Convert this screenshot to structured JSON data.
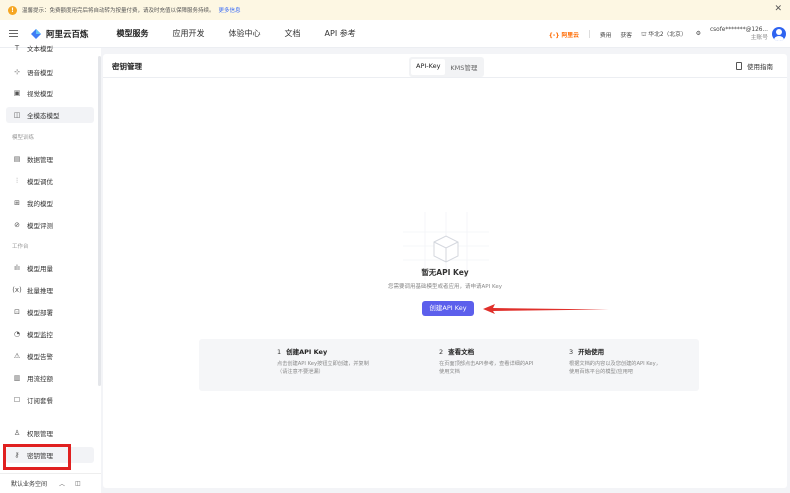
{
  "notice": {
    "text": "温馨提示：免费额度用完后将自动转为按量付费，请及时充值以保障服务持续。",
    "more": "更多信息"
  },
  "topnav": {
    "logo": "阿里云百炼",
    "menu": [
      "模型服务",
      "应用开发",
      "体验中心",
      "文档",
      "API 参考"
    ],
    "brand": "阿里云",
    "fee": "费用",
    "ticket": "获客",
    "region": "华北2（北京）",
    "user_name": "csofe*******@126...",
    "user_role": "主账号"
  },
  "sidebar": {
    "items_top": [
      {
        "icon": "text-model-icon",
        "glyph": "T",
        "label": "文本模型"
      },
      {
        "icon": "audio-model-icon",
        "glyph": "⊹",
        "label": "语音模型"
      },
      {
        "icon": "vision-model-icon",
        "glyph": "▣",
        "label": "视觉模型"
      },
      {
        "icon": "omni-model-icon",
        "glyph": "◫",
        "label": "全模态模型"
      }
    ],
    "group_training": "模型训练",
    "items_training": [
      {
        "icon": "data-manage-icon",
        "glyph": "▤",
        "label": "数据管理"
      },
      {
        "icon": "tuning-icon",
        "glyph": "⫶",
        "label": "模型调优"
      },
      {
        "icon": "my-models-icon",
        "glyph": "⊞",
        "label": "我的模型"
      },
      {
        "icon": "evaluation-icon",
        "glyph": "⊘",
        "label": "模型评测"
      }
    ],
    "group_work": "工作台",
    "items_work": [
      {
        "icon": "usage-icon",
        "glyph": "ılı",
        "label": "模型用量"
      },
      {
        "icon": "batch-icon",
        "glyph": "(x)",
        "label": "批量推理"
      },
      {
        "icon": "deploy-icon",
        "glyph": "⊡",
        "label": "模型部署"
      },
      {
        "icon": "monitor-icon",
        "glyph": "◔",
        "label": "模型监控"
      },
      {
        "icon": "alert-icon",
        "glyph": "⚠",
        "label": "模型告警"
      },
      {
        "icon": "traffic-icon",
        "glyph": "▥",
        "label": "用流控额"
      },
      {
        "icon": "subscribe-icon",
        "glyph": "☐",
        "label": "订阅套餐"
      }
    ],
    "items_bottom": [
      {
        "icon": "permission-icon",
        "glyph": "♙",
        "label": "权限管理"
      },
      {
        "icon": "key-icon",
        "glyph": "⚷",
        "label": "密钥管理"
      }
    ],
    "workspace": "默认业务空间"
  },
  "page": {
    "title": "密钥管理",
    "tabs": [
      "API-Key",
      "KMS管理"
    ],
    "guide": "使用指南",
    "empty_title": "暂无API Key",
    "empty_desc": "您需要调用基础模型或者应用，请申请API Key",
    "create_button": "创建API Key",
    "steps": [
      {
        "num": "1",
        "title": "创建API Key",
        "desc": "点击创建API Key按钮立即创建，并复制（请注意不要泄漏）"
      },
      {
        "num": "2",
        "title": "查看文档",
        "desc": "在页面顶部点击API参考，查看详细的API使用文档"
      },
      {
        "num": "3",
        "title": "开始使用",
        "desc": "根据文档的内容以及您创建的API Key，使用百炼平台的模型/应用吧"
      }
    ]
  },
  "colors": {
    "primary": "#5c5fec",
    "highlight": "#e02020",
    "brand_orange": "#ff6a00"
  }
}
